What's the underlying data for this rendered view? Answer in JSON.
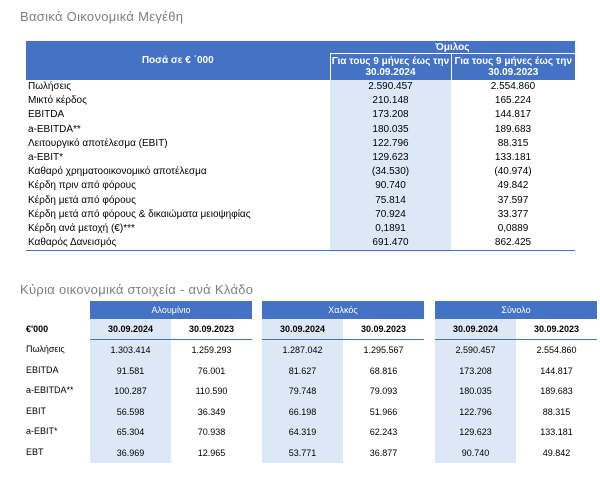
{
  "title1": "Βασικά Οικονομικά Μεγέθη",
  "title2": "Κύρια οικονομικά στοιχεία - ανά Κλάδο",
  "top_table": {
    "label_header": "Ποσά σε € ΄000",
    "group_header": "Όμιλος",
    "col1_header": "Για τους 9 μήνες έως την 30.09.2024",
    "col2_header": "Για τους 9 μήνες έως την 30.09.2023",
    "rows": [
      {
        "label": "Πωλήσεις",
        "v1": "2.590.457",
        "v2": "2.554.860"
      },
      {
        "label": "Μικτό κέρδος",
        "v1": "210.148",
        "v2": "165.224"
      },
      {
        "label": "EBITDA",
        "v1": "173.208",
        "v2": "144.817"
      },
      {
        "label": "a-EBITDA**",
        "v1": "180.035",
        "v2": "189.683"
      },
      {
        "label": "Λειτουργικό αποτέλεσμα (EBIT)",
        "v1": "122.796",
        "v2": "88.315"
      },
      {
        "label": "a-EBIT*",
        "v1": "129.623",
        "v2": "133.181"
      },
      {
        "label": "Καθαρό χρηματοοικονομικό αποτέλεσμα",
        "v1": "(34.530)",
        "v2": "(40.974)"
      },
      {
        "label": "Κέρδη πριν από φόρους",
        "v1": "90.740",
        "v2": "49.842"
      },
      {
        "label": "Κέρδη μετά από φόρους",
        "v1": "75.814",
        "v2": "37.597"
      },
      {
        "label": "Κέρδη μετά από φόρους & δικαιώματα μειοψηφίας",
        "v1": "70.924",
        "v2": "33.377"
      },
      {
        "label": "Κέρδη ανά μετοχή (€)***",
        "v1": "0,1891",
        "v2": "0,0889"
      },
      {
        "label": "Καθαρός Δανεισμός",
        "v1": "691.470",
        "v2": "862.425"
      }
    ]
  },
  "segments": {
    "unit_label": "€'000",
    "row_labels": [
      "Πωλήσεις",
      "EBITDA",
      "a-EBITDA**",
      "EBIT",
      "a-EBIT*",
      "EBT"
    ],
    "items": [
      {
        "name": "Αλουμίνιο",
        "c1": "30.09.2024",
        "c2": "30.09.2023",
        "rows": [
          [
            "1.303.414",
            "1.259.293"
          ],
          [
            "91.581",
            "76.001"
          ],
          [
            "100.287",
            "110.590"
          ],
          [
            "56.598",
            "36.349"
          ],
          [
            "65.304",
            "70.938"
          ],
          [
            "36.969",
            "12.965"
          ]
        ]
      },
      {
        "name": "Χαλκός",
        "c1": "30.09.2024",
        "c2": "30.09.2023",
        "rows": [
          [
            "1.287.042",
            "1.295.567"
          ],
          [
            "81.627",
            "68.816"
          ],
          [
            "79.748",
            "79.093"
          ],
          [
            "66.198",
            "51.966"
          ],
          [
            "64.319",
            "62.243"
          ],
          [
            "53.771",
            "36.877"
          ]
        ]
      },
      {
        "name": "Σύνολο",
        "c1": "30.09.2024",
        "c2": "30.09.2023",
        "rows": [
          [
            "2.590.457",
            "2.554.860"
          ],
          [
            "173.208",
            "144.817"
          ],
          [
            "180.035",
            "189.683"
          ],
          [
            "122.796",
            "88.315"
          ],
          [
            "129.623",
            "133.181"
          ],
          [
            "90.740",
            "49.842"
          ]
        ]
      }
    ]
  },
  "colors": {
    "header_blue": "#4472c4",
    "highlight": "#dde8f6",
    "title_gray": "#7f7f7f"
  }
}
